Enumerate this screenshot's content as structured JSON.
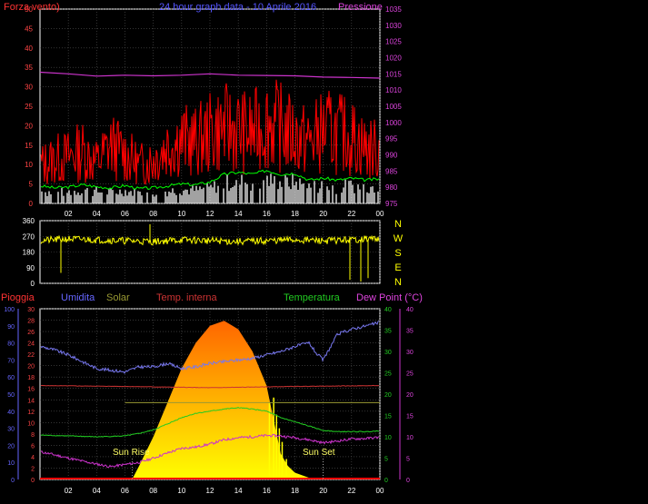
{
  "chart_data": [
    {
      "type": "line",
      "title": "24 hour graph data - 10 Aprile 2016",
      "y_left_label": "Forza vento)",
      "y_right_label": "Pressione",
      "y_left_ticks": [
        "0",
        "5",
        "10",
        "15",
        "20",
        "25",
        "30",
        "35",
        "40",
        "45",
        "50"
      ],
      "y_right_ticks": [
        "975",
        "980",
        "985",
        "990",
        "995",
        "1000",
        "1005",
        "1010",
        "1015",
        "1020",
        "1025",
        "1030",
        "1035"
      ],
      "y_left_range": [
        0,
        50
      ],
      "y_right_range": [
        975,
        1035
      ],
      "x_ticks": [
        "02",
        "04",
        "06",
        "08",
        "10",
        "12",
        "14",
        "16",
        "18",
        "20",
        "22",
        "00"
      ],
      "x_range_hours": [
        0,
        24
      ],
      "grid": true,
      "colors": {
        "wind_gust": "#ff0000",
        "wind_avg": "#00ff00",
        "wind_speed": "#ffffff",
        "pressure": "#cc33cc"
      },
      "series": [
        {
          "name": "",
          "color": "#cc33cc",
          "axis": "right",
          "x": [
            0,
            2,
            4,
            6,
            8,
            10,
            12,
            14,
            16,
            18,
            20,
            22,
            24
          ],
          "y": [
            1015.5,
            1015.0,
            1014.3,
            1014.6,
            1014.4,
            1014.6,
            1015.0,
            1014.6,
            1014.5,
            1014.4,
            1014.0,
            1013.9,
            1013.7
          ]
        },
        {
          "name": "",
          "color": "#00ff00",
          "axis": "left",
          "x": [
            0,
            1,
            2,
            3,
            4,
            5,
            6,
            7,
            8,
            9,
            10,
            11,
            12,
            13,
            14,
            15,
            16,
            17,
            18,
            19,
            20,
            21,
            22,
            23,
            24
          ],
          "y": [
            4.5,
            4.0,
            4.2,
            4.8,
            4.3,
            4.0,
            4.6,
            3.8,
            4.0,
            4.5,
            5.0,
            4.8,
            5.5,
            7.5,
            8.0,
            7.5,
            8.5,
            7.5,
            7.8,
            6.0,
            6.5,
            6.0,
            6.5,
            6.0,
            6.3
          ]
        },
        {
          "name": "",
          "color": "#ff0000",
          "axis": "left",
          "x": [
            0,
            1,
            2,
            3,
            4,
            5,
            6,
            7,
            8,
            9,
            10,
            11,
            12,
            13,
            14,
            15,
            16,
            17,
            18,
            19,
            20,
            21,
            22,
            23,
            24
          ],
          "y": [
            13,
            15,
            16,
            18,
            14,
            20,
            17,
            13,
            15,
            20,
            22,
            21,
            24,
            26,
            25,
            24,
            28,
            26,
            23,
            21,
            25,
            24,
            23,
            19,
            18
          ]
        }
      ]
    },
    {
      "type": "scatter",
      "y_ticks": [
        "0",
        "90",
        "180",
        "270",
        "360"
      ],
      "y_range": [
        0,
        360
      ],
      "compass_labels": [
        "N",
        "W",
        "S",
        "E",
        "N"
      ],
      "color": "#ffff00",
      "series": [
        {
          "name": "",
          "x": [
            0,
            2,
            4,
            6,
            8,
            10,
            12,
            14,
            16,
            18,
            20,
            22,
            24
          ],
          "y": [
            245,
            255,
            250,
            245,
            240,
            250,
            245,
            240,
            245,
            250,
            245,
            250,
            260
          ]
        }
      ]
    },
    {
      "type": "area",
      "labels": {
        "rain": "Pioggia",
        "humidity": "Umidita",
        "solar": "Solar",
        "temp_in": "Temp. interna",
        "temperature": "Temperatura",
        "dew_point": "Dew Point (°C)"
      },
      "annotations": [
        "Sun Rise",
        "Sun Set"
      ],
      "y_left1_ticks": [
        "0",
        "10",
        "20",
        "30",
        "40",
        "50",
        "60",
        "70",
        "80",
        "90",
        "100"
      ],
      "y_left2_ticks": [
        "0",
        "2",
        "4",
        "6",
        "8",
        "10",
        "12",
        "14",
        "16",
        "18",
        "20",
        "22",
        "24",
        "26",
        "28",
        "30"
      ],
      "y_right1_ticks": [
        "0",
        "5",
        "10",
        "15",
        "20",
        "25",
        "30",
        "35",
        "40"
      ],
      "y_right2_ticks": [
        "0",
        "5",
        "10",
        "15",
        "20",
        "25",
        "30",
        "35",
        "40"
      ],
      "x_ticks": [
        "02",
        "04",
        "06",
        "08",
        "10",
        "12",
        "14",
        "16",
        "18",
        "20",
        "22",
        "00"
      ],
      "colors": {
        "rain": "#6666ff",
        "humidity": "#7777ee",
        "solar": "#999933",
        "temp_in": "#cc3333",
        "temperature": "#22cc22",
        "dew_point": "#cc33cc",
        "solar_area_top": "#ff6600",
        "solar_area_bottom": "#ffff00"
      },
      "series": [
        {
          "name": "Umidita",
          "unit": "%",
          "x": [
            0,
            1,
            2,
            3,
            4,
            5,
            6,
            7,
            8,
            9,
            10,
            11,
            12,
            13,
            14,
            15,
            16,
            17,
            18,
            19,
            19.5,
            20,
            21,
            22,
            23,
            24
          ],
          "y": [
            78,
            76,
            73,
            69,
            65,
            64,
            63,
            66,
            66,
            68,
            65,
            66,
            68,
            69,
            70,
            71,
            73,
            75,
            78,
            80,
            74,
            70,
            85,
            88,
            90,
            92
          ]
        },
        {
          "name": "Temp. interna",
          "unit": "°C",
          "x": [
            0,
            6,
            12,
            18,
            24
          ],
          "y": [
            22,
            21.8,
            21.5,
            21.8,
            22
          ]
        },
        {
          "name": "Temperatura",
          "unit": "°C",
          "x": [
            0,
            2,
            4,
            6,
            7,
            8,
            9,
            10,
            11,
            12,
            13,
            14,
            15,
            16,
            17,
            18,
            19,
            20,
            21,
            22,
            23,
            24
          ],
          "y": [
            10.4,
            10.2,
            10.0,
            10.2,
            10.8,
            11.6,
            13.0,
            14.5,
            15.5,
            16.0,
            16.5,
            16.8,
            16.5,
            16.0,
            14.5,
            13.5,
            12.5,
            11.5,
            11.2,
            11.2,
            11.2,
            11.4
          ]
        },
        {
          "name": "Dew Point (°C)",
          "unit": "°C",
          "x": [
            0,
            1,
            2,
            3,
            4,
            5,
            6,
            7,
            8,
            9,
            10,
            11,
            12,
            13,
            14,
            15,
            16,
            17,
            18,
            19,
            20,
            21,
            22,
            23,
            24
          ],
          "y": [
            6.5,
            5.8,
            5.0,
            4.3,
            3.6,
            3.0,
            3.5,
            4.0,
            5.0,
            6.2,
            7.3,
            7.6,
            8.3,
            9.3,
            9.8,
            10.0,
            10.3,
            10.2,
            9.8,
            9.3,
            8.6,
            9.0,
            9.5,
            9.6,
            9.9
          ]
        },
        {
          "name": "Solar",
          "unit": "W/m²",
          "x": [
            6.5,
            7,
            8,
            9,
            10,
            11,
            12,
            13,
            14,
            15,
            16,
            16.5,
            17,
            17.5,
            18,
            19,
            20
          ],
          "y": [
            0,
            8,
            25,
            45,
            65,
            80,
            90,
            93,
            88,
            75,
            55,
            35,
            15,
            8,
            4,
            1,
            0
          ]
        }
      ]
    }
  ]
}
